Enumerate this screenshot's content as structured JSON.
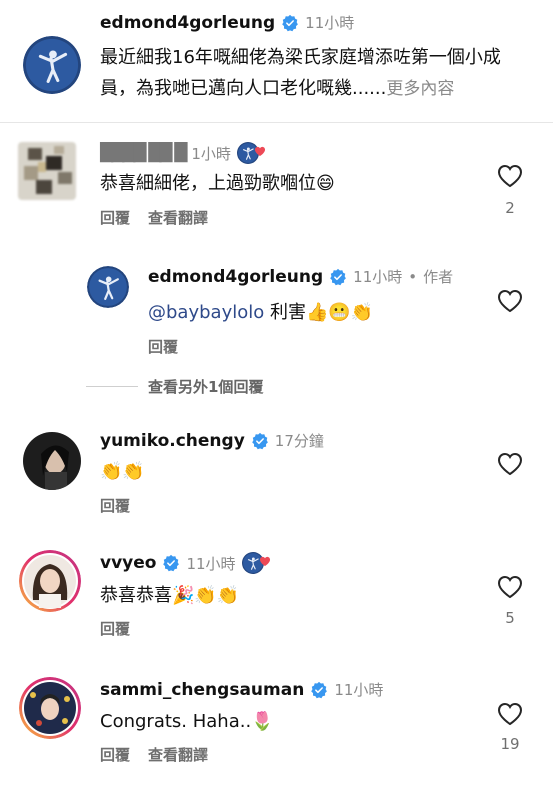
{
  "post": {
    "username": "edmond4gorleung",
    "time": "11小時",
    "caption": "最近細我16年嘅細佬為梁氏家庭增添咗第一個小成員，為我哋已邁向人口老化嘅幾......",
    "more": "更多內容"
  },
  "comments": [
    {
      "username": "████ ██ █",
      "time": "1小時",
      "text": "恭喜細細佬，上過勁歌嗰位😄",
      "reply_label": "回覆",
      "translate_label": "查看翻譯",
      "likes": "2",
      "reply": {
        "username": "edmond4gorleung",
        "time": "11小時",
        "author_tag": "作者",
        "mention": "@baybaylolo",
        "text": " 利害👍😬👏",
        "reply_label": "回覆"
      },
      "more_replies": "查看另外1個回覆"
    },
    {
      "username": "yumiko.chengy",
      "time": "17分鐘",
      "text": "👏👏",
      "reply_label": "回覆"
    },
    {
      "username": "vvyeo",
      "time": "11小時",
      "text": "恭喜恭喜🎉👏👏",
      "reply_label": "回覆",
      "likes": "5"
    },
    {
      "username": "sammi_chengsauman",
      "time": "11小時",
      "text": "Congrats. Haha..🌷",
      "reply_label": "回覆",
      "translate_label": "查看翻譯",
      "likes": "19"
    }
  ],
  "colors": {
    "verified": "#3897f0",
    "heart_badge": "#ed4956",
    "mention": "#2f4a8a"
  },
  "icons": [
    "verified-badge-icon",
    "heart-icon",
    "liked-by-creator-icon"
  ]
}
